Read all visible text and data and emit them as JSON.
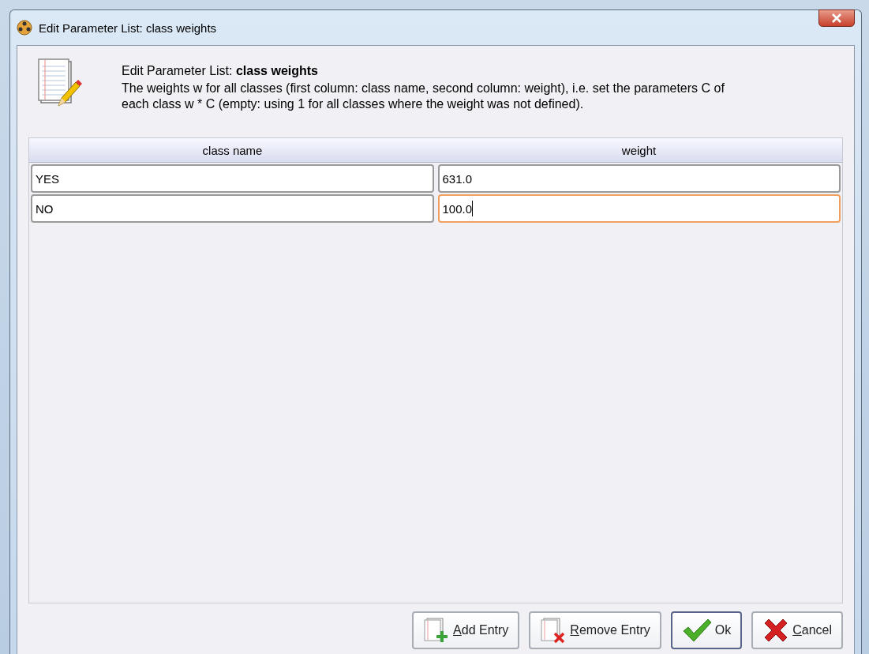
{
  "window": {
    "title": "Edit Parameter List: class weights"
  },
  "header": {
    "title": "Edit Parameter List: **class weights**",
    "description": "The weights w for all classes (first column: class name, second column: weight), i.e. set the parameters C of each class w * C (empty: using 1 for all classes where the weight was not defined)."
  },
  "table": {
    "columns": [
      "class name",
      "weight"
    ],
    "rows": [
      [
        {
          "value": "YES",
          "focused": false
        },
        {
          "value": "631.0",
          "focused": false
        }
      ],
      [
        {
          "value": "NO",
          "focused": false
        },
        {
          "value": "100.0",
          "focused": true
        }
      ]
    ]
  },
  "buttons": [
    {
      "kind": "add",
      "mnemonic": "A",
      "rest": "dd Entry"
    },
    {
      "kind": "remove",
      "mnemonic": "R",
      "rest": "emove Entry"
    },
    {
      "kind": "ok",
      "rest": "Ok"
    },
    {
      "kind": "cancel",
      "mnemonic": "C",
      "rest": "ancel"
    }
  ]
}
